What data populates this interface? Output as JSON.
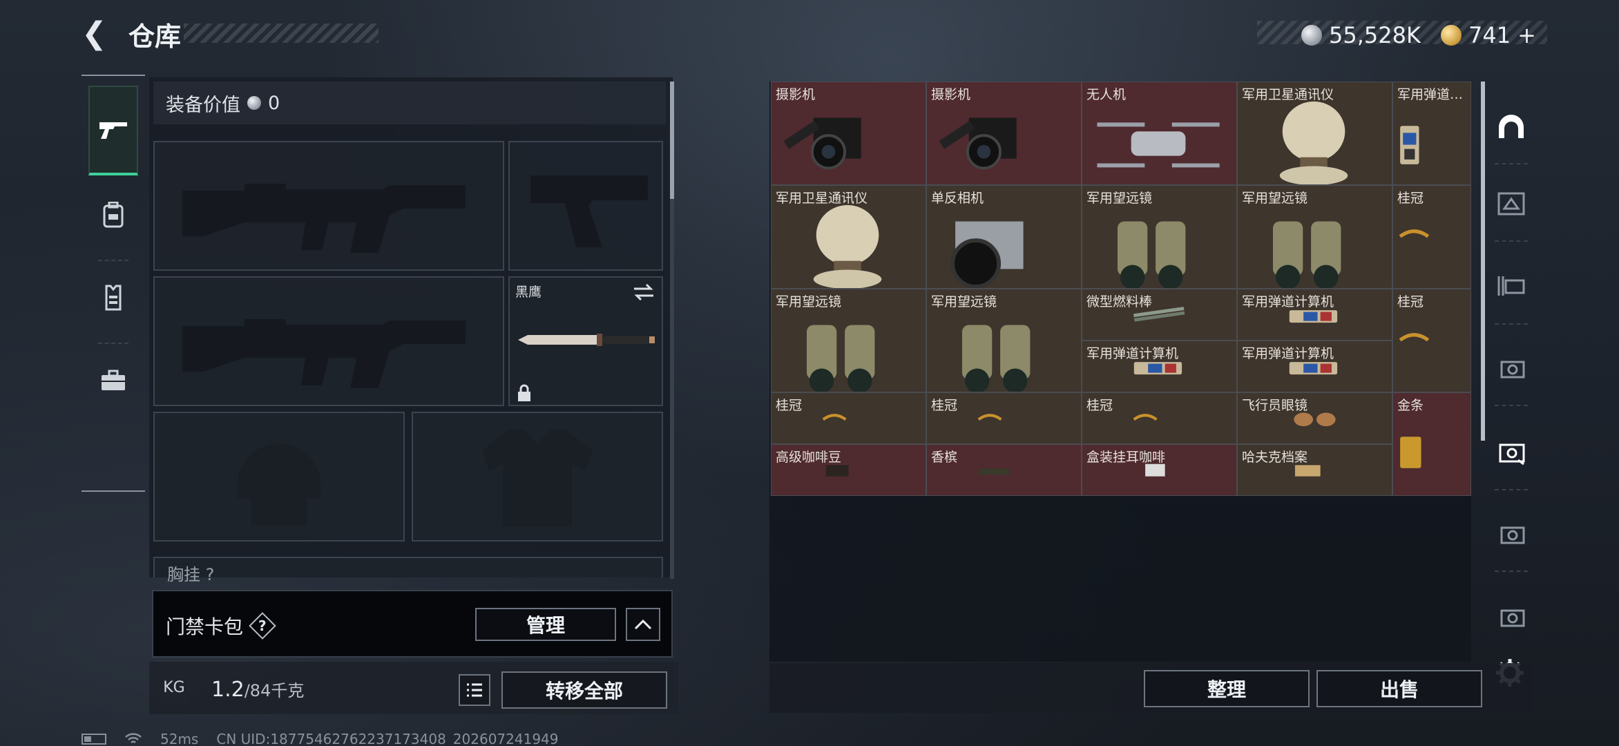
{
  "header": {
    "title": "仓库",
    "currency_silver": "55,528K",
    "currency_gold": "741",
    "add_label": "+"
  },
  "left_tabs": [
    {
      "name": "weapons",
      "icon": "pistol-icon"
    },
    {
      "name": "backpack",
      "icon": "backpack-icon"
    },
    {
      "name": "vest",
      "icon": "vest-icon"
    },
    {
      "name": "case",
      "icon": "briefcase-icon"
    }
  ],
  "equipment": {
    "value_label": "装备价值",
    "value": "0",
    "melee_name": "黑鹰",
    "partial_label": "胸挂",
    "partial_suffix": "?"
  },
  "keycard": {
    "label": "门禁卡包",
    "help": "?",
    "manage_button": "管理",
    "collapse_icon": "chevron-up-icon"
  },
  "weight": {
    "current": "1.2",
    "max": "/84千克",
    "kg_icon": "KG"
  },
  "actions": {
    "transfer_all": "转移全部",
    "sort": "整理",
    "sell": "出售"
  },
  "stash_items": [
    {
      "name": "摄影机",
      "rarity": "red"
    },
    {
      "name": "摄影机",
      "rarity": "red"
    },
    {
      "name": "无人机",
      "rarity": "red"
    },
    {
      "name": "军用卫星通讯仪",
      "rarity": "brown"
    },
    {
      "name": "军用弹道…",
      "rarity": "brown"
    },
    {
      "name": "军用卫星通讯仪",
      "rarity": "brown"
    },
    {
      "name": "单反相机",
      "rarity": "brown"
    },
    {
      "name": "军用望远镜",
      "rarity": "brown"
    },
    {
      "name": "军用望远镜",
      "rarity": "brown"
    },
    {
      "name": "桂冠",
      "rarity": "brown"
    },
    {
      "name": "军用望远镜",
      "rarity": "brown"
    },
    {
      "name": "军用望远镜",
      "rarity": "brown"
    },
    {
      "name": "微型燃料棒",
      "rarity": "brown"
    },
    {
      "name": "军用弹道计算机",
      "rarity": "brown"
    },
    {
      "name": "桂冠",
      "rarity": "brown"
    },
    {
      "name": "军用弹道计算机",
      "rarity": "brown"
    },
    {
      "name": "军用弹道计算机",
      "rarity": "brown"
    },
    {
      "name": "桂冠",
      "rarity": "brown"
    },
    {
      "name": "桂冠",
      "rarity": "brown"
    },
    {
      "name": "桂冠",
      "rarity": "brown"
    },
    {
      "name": "飞行员眼镜",
      "rarity": "brown"
    },
    {
      "name": "金条",
      "rarity": "red"
    },
    {
      "name": "高级咖啡豆",
      "rarity": "red"
    },
    {
      "name": "香槟",
      "rarity": "red"
    },
    {
      "name": "盒装挂耳咖啡",
      "rarity": "red"
    },
    {
      "name": "哈夫克档案",
      "rarity": "brown"
    }
  ],
  "right_tabs": [
    "helmet-icon",
    "armor-icon-III",
    "armor-icon-II",
    "armor-icon-IV",
    "safe-icon",
    "armor-icon-IV-b",
    "armor-icon-IV-c"
  ],
  "status_bar": {
    "ping": "52ms",
    "uid": "CN UID:18775462762237173408_202607241949"
  },
  "colors": {
    "accent": "#3fd19a",
    "rarity_red": "#4f2a2f",
    "rarity_brown": "#3e352d"
  }
}
